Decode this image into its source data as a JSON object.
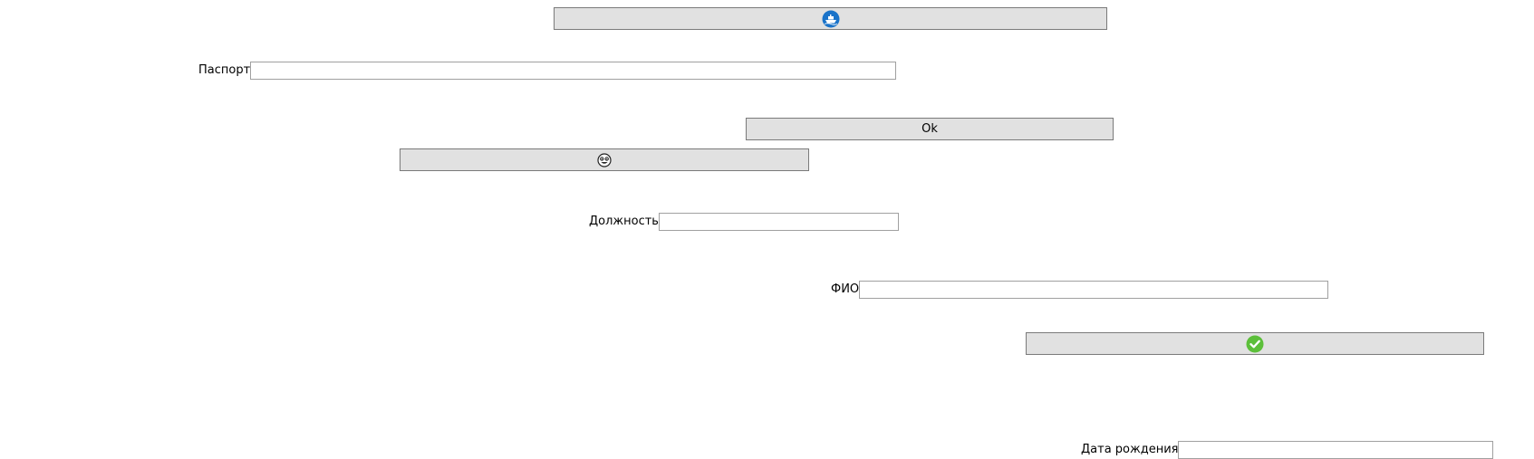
{
  "buttons": {
    "top_button": {
      "icon": "blue-boat-icon",
      "label": ""
    },
    "ok_button": {
      "label": "Ok"
    },
    "middle_button": {
      "icon": "face-emoji-icon",
      "label": ""
    },
    "confirm_button": {
      "icon": "green-checkmark-icon",
      "label": ""
    }
  },
  "fields": {
    "passport": {
      "label": "Паспорт",
      "value": ""
    },
    "position": {
      "label": "Должность",
      "value": ""
    },
    "full_name": {
      "label": "ФИО",
      "value": ""
    },
    "birth_date": {
      "label": "Дата рождения",
      "value": ""
    }
  },
  "colors": {
    "button_bg": "#e1e1e1",
    "button_border": "#7a7a7a",
    "input_border": "#a0a0a0",
    "boat_icon_blue": "#1a73c9",
    "check_icon_green": "#5cbf3a"
  }
}
